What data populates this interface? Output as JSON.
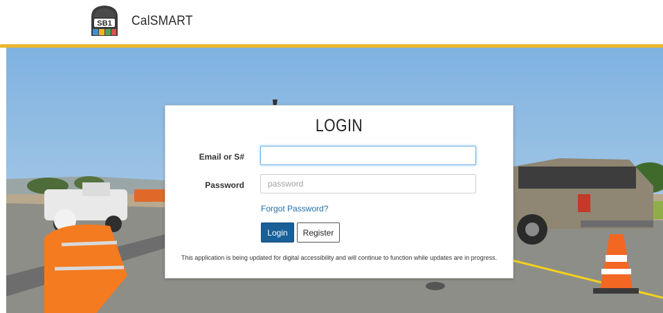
{
  "header": {
    "logo_text": "SB1",
    "brand": "CalSMART"
  },
  "login": {
    "title": "LOGIN",
    "email_label": "Email or S#",
    "email_value": "",
    "email_placeholder": "",
    "password_label": "Password",
    "password_value": "",
    "password_placeholder": "password",
    "forgot_link": "Forgot Password?",
    "login_button": "Login",
    "register_button": "Register",
    "notice": "This application is being updated for digital accessibility and will continue to function while updates are in progress."
  },
  "colors": {
    "accent_bar": "#e9b82c",
    "primary_button": "#1a5f96",
    "link": "#1f6fa8"
  }
}
